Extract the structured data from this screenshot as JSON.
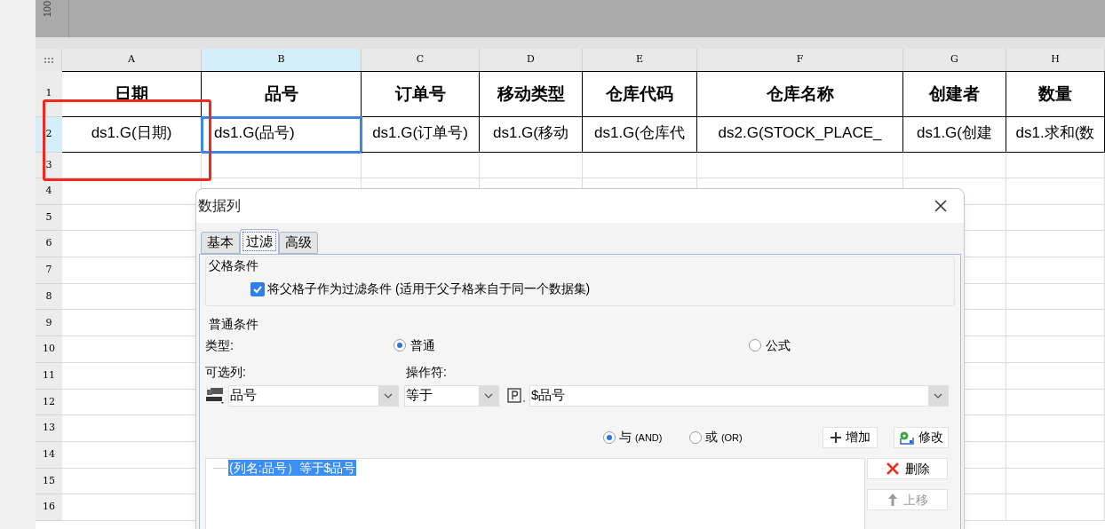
{
  "ruler": {
    "label": "100"
  },
  "sheet": {
    "columns": [
      {
        "label": "A",
        "selected": false
      },
      {
        "label": "B",
        "selected": true
      },
      {
        "label": "C",
        "selected": false
      },
      {
        "label": "D",
        "selected": false
      },
      {
        "label": "E",
        "selected": false
      },
      {
        "label": "F",
        "selected": false
      },
      {
        "label": "G",
        "selected": false
      },
      {
        "label": "H",
        "selected": false
      }
    ],
    "rows": [
      {
        "number": "1",
        "selected": false,
        "kind": "header",
        "cells": [
          {
            "text": "日期",
            "selected": false
          },
          {
            "text": "品号",
            "selected": false
          },
          {
            "text": "订单号",
            "selected": false
          },
          {
            "text": "移动类型",
            "selected": false
          },
          {
            "text": "仓库代码",
            "selected": false
          },
          {
            "text": "仓库名称",
            "selected": false
          },
          {
            "text": "创建者",
            "selected": false
          },
          {
            "text": "数量",
            "selected": false
          }
        ]
      },
      {
        "number": "2",
        "selected": true,
        "kind": "data",
        "cells": [
          {
            "text": "ds1.G(日期)",
            "selected": false
          },
          {
            "text": "ds1.G(品号)",
            "selected": true
          },
          {
            "text": "ds1.G(订单号)",
            "selected": false
          },
          {
            "text": "ds1.G(移动",
            "selected": false
          },
          {
            "text": "ds1.G(仓库代",
            "selected": false
          },
          {
            "text": "ds2.G(STOCK_PLACE_",
            "selected": false
          },
          {
            "text": "ds1.G(创建",
            "selected": false
          },
          {
            "text": "ds1.求和(数",
            "selected": false
          }
        ]
      },
      {
        "number": "3",
        "selected": false,
        "kind": "empty"
      },
      {
        "number": "4",
        "selected": false,
        "kind": "empty"
      },
      {
        "number": "5",
        "selected": false,
        "kind": "empty"
      },
      {
        "number": "6",
        "selected": false,
        "kind": "empty"
      },
      {
        "number": "7",
        "selected": false,
        "kind": "empty"
      },
      {
        "number": "8",
        "selected": false,
        "kind": "empty"
      },
      {
        "number": "9",
        "selected": false,
        "kind": "empty"
      },
      {
        "number": "10",
        "selected": false,
        "kind": "empty"
      },
      {
        "number": "11",
        "selected": false,
        "kind": "empty"
      },
      {
        "number": "12",
        "selected": false,
        "kind": "empty"
      },
      {
        "number": "13",
        "selected": false,
        "kind": "empty"
      },
      {
        "number": "14",
        "selected": false,
        "kind": "empty"
      },
      {
        "number": "15",
        "selected": false,
        "kind": "empty"
      },
      {
        "number": "16",
        "selected": false,
        "kind": "empty"
      }
    ]
  },
  "dialog": {
    "title": "数据列",
    "tabs": [
      {
        "label": "基本",
        "selected": false
      },
      {
        "label": "过滤",
        "selected": true
      },
      {
        "label": "高级",
        "selected": false
      }
    ],
    "parent_section": {
      "title": "父格条件",
      "checkbox": {
        "label": "将父格子作为过滤条件 (适用于父子格来自于同一个数据集)",
        "checked": true
      }
    },
    "normal_section": {
      "title": "普通条件",
      "type_label": "类型:",
      "type_options": [
        {
          "label": "普通",
          "selected": true
        },
        {
          "label": "公式",
          "selected": false
        }
      ],
      "column_label": "可选列:",
      "column_value": "品号",
      "operator_label": "操作符:",
      "operator_value": "等于",
      "value": "$品号",
      "logic_options": [
        {
          "label": "与",
          "sub": "(AND)",
          "selected": true
        },
        {
          "label": "或",
          "sub": "(OR)",
          "selected": false
        }
      ],
      "add_button": "增加",
      "edit_button": "修改",
      "conditions": [
        {
          "text": "(列名:品号）等于$品号",
          "selected": true
        }
      ],
      "side_buttons": [
        {
          "kind": "delete",
          "label": "删除",
          "disabled": false
        },
        {
          "kind": "up",
          "label": "上移",
          "disabled": true
        }
      ]
    }
  }
}
